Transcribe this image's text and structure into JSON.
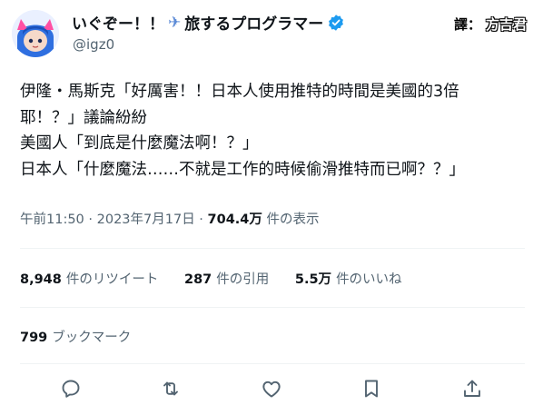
{
  "header": {
    "display_name": "いぐぞー！！",
    "display_name_suffix": "旅するプログラマー",
    "handle": "@igz0",
    "icons": [
      "avatar",
      "airplane-icon",
      "verified-badge-icon"
    ]
  },
  "watermark": {
    "mark": "譯：",
    "name": "方吉君"
  },
  "tweet": {
    "lines": [
      "伊隆・馬斯克「好厲害！！日本人使用推特的時間是美國的3倍",
      "耶！？」議論紛紛",
      "美國人「到底是什麼魔法啊！？」",
      "日本人「什麼魔法……不就是工作的時候偷滑推特而已啊？？」"
    ]
  },
  "meta": {
    "time": "午前11:50",
    "separator": " · ",
    "date": "2023年7月17日",
    "views_count": "704.4万",
    "views_label": "件の表示"
  },
  "stats": {
    "retweets": {
      "count": "8,948",
      "label": "件のリツイート"
    },
    "quotes": {
      "count": "287",
      "label": "件の引用"
    },
    "likes": {
      "count": "5.5万",
      "label": "件のいいね"
    },
    "bookmarks": {
      "count": "799",
      "label": "ブックマーク"
    }
  },
  "actions": [
    "reply-icon",
    "retweet-icon",
    "like-icon",
    "bookmark-icon",
    "share-icon"
  ],
  "colors": {
    "text": "#0f1419",
    "secondary": "#536471",
    "verified": "#1d9bf0",
    "divider": "#eff3f4",
    "airplane": "#5b8ad6"
  }
}
